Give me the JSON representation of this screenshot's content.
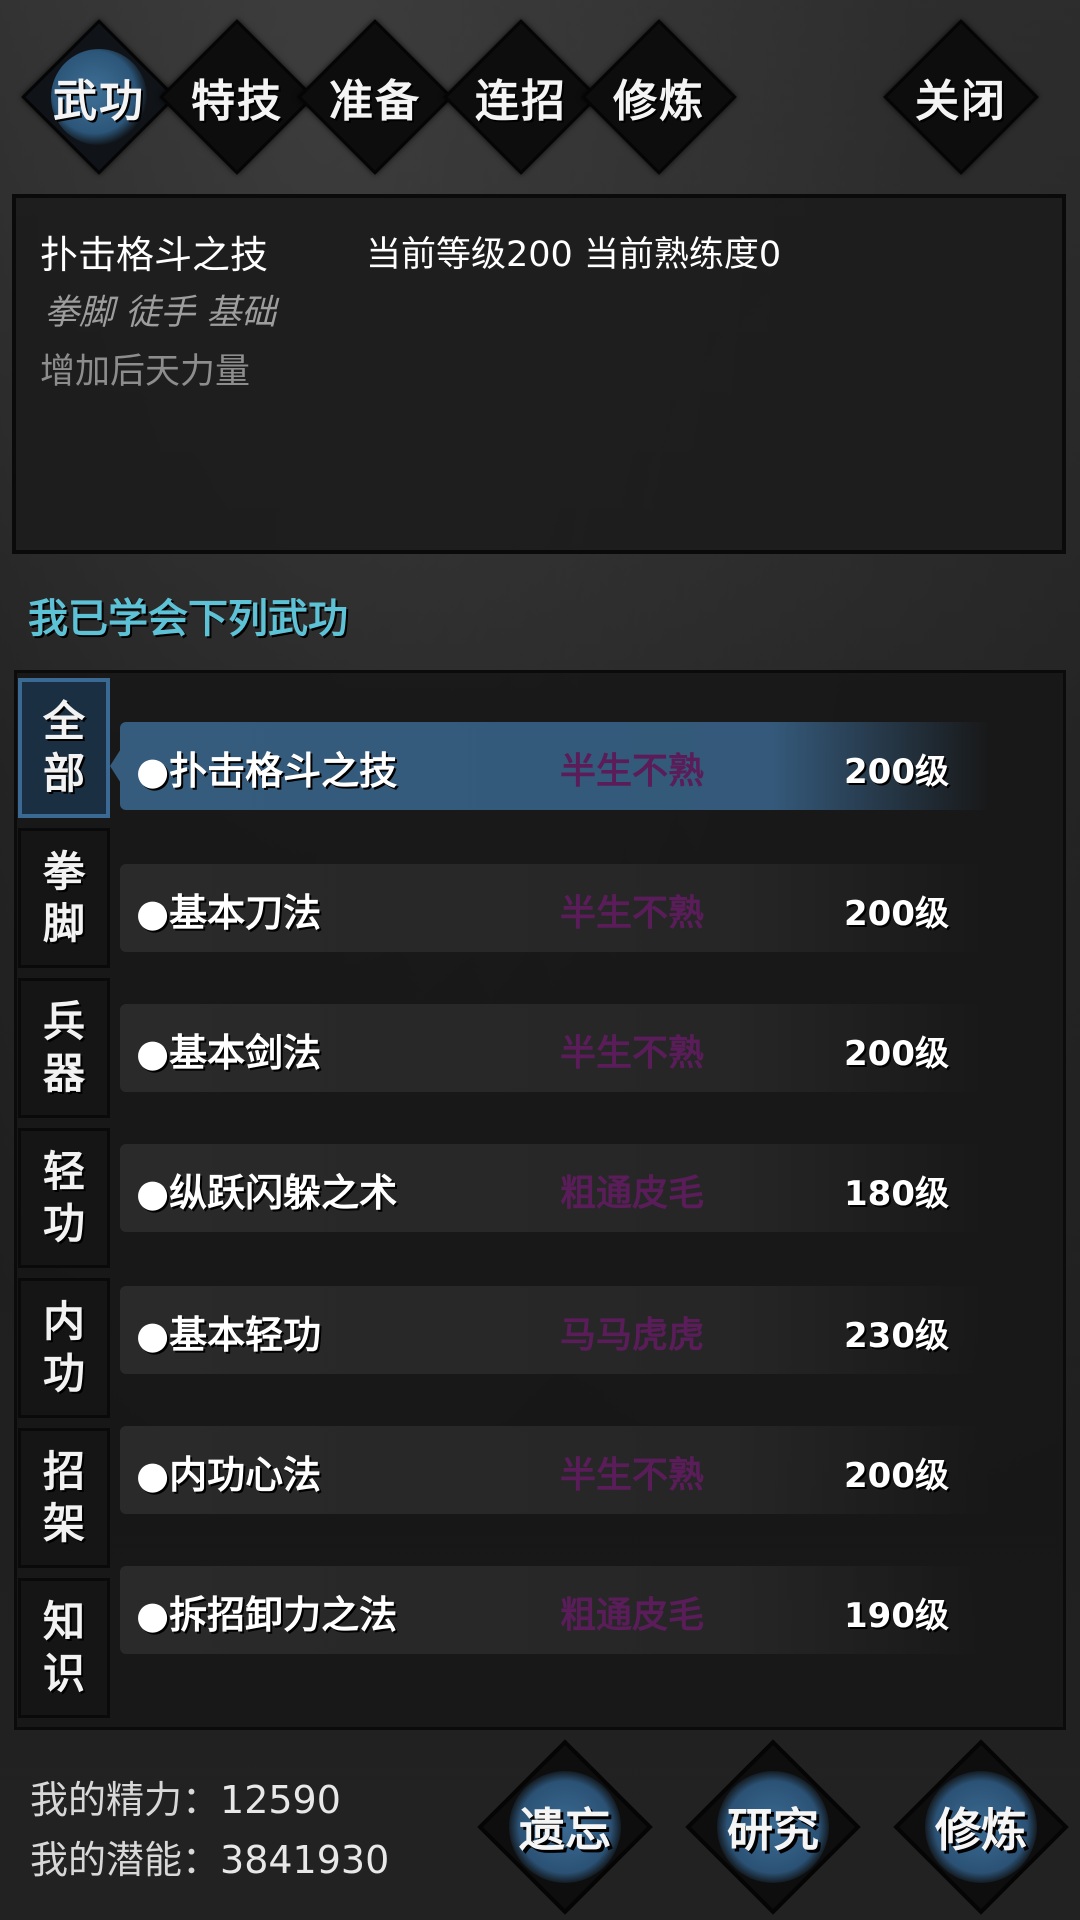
{
  "tabs": [
    {
      "label": "武功",
      "active": true
    },
    {
      "label": "特技",
      "active": false
    },
    {
      "label": "准备",
      "active": false
    },
    {
      "label": "连招",
      "active": false
    },
    {
      "label": "修炼",
      "active": false
    },
    {
      "label": "关闭",
      "active": false
    }
  ],
  "info": {
    "name": "扑击格斗之技",
    "level_text": "当前等级200  当前熟练度0",
    "tags": "拳脚 徒手 基础",
    "desc": "增加后天力量"
  },
  "section_title": "我已学会下列武功",
  "categories": [
    {
      "c1": "全",
      "c2": "部"
    },
    {
      "c1": "拳",
      "c2": "脚"
    },
    {
      "c1": "兵",
      "c2": "器"
    },
    {
      "c1": "轻",
      "c2": "功"
    },
    {
      "c1": "内",
      "c2": "功"
    },
    {
      "c1": "招",
      "c2": "架"
    },
    {
      "c1": "知",
      "c2": "识"
    }
  ],
  "skills": [
    {
      "name": "●扑击格斗之技",
      "proficiency": "半生不熟",
      "level": "200级"
    },
    {
      "name": "●基本刀法",
      "proficiency": "半生不熟",
      "level": "200级"
    },
    {
      "name": "●基本剑法",
      "proficiency": "半生不熟",
      "level": "200级"
    },
    {
      "name": "●纵跃闪躲之术",
      "proficiency": "粗通皮毛",
      "level": "180级"
    },
    {
      "name": "●基本轻功",
      "proficiency": "马马虎虎",
      "level": "230级"
    },
    {
      "name": "●内功心法",
      "proficiency": "半生不熟",
      "level": "200级"
    },
    {
      "name": "●拆招卸力之法",
      "proficiency": "粗通皮毛",
      "level": "190级"
    }
  ],
  "stats": {
    "energy_label": "我的精力：",
    "energy_value": "12590",
    "potential_label": "我的潜能：",
    "potential_value": "3841930"
  },
  "actions": {
    "forget": "遗忘",
    "research": "研究",
    "practice": "修炼"
  },
  "colors": {
    "accent_blue": "#355c7d",
    "section_title": "#5ec2d6",
    "proficiency": "#5a1d5a"
  }
}
